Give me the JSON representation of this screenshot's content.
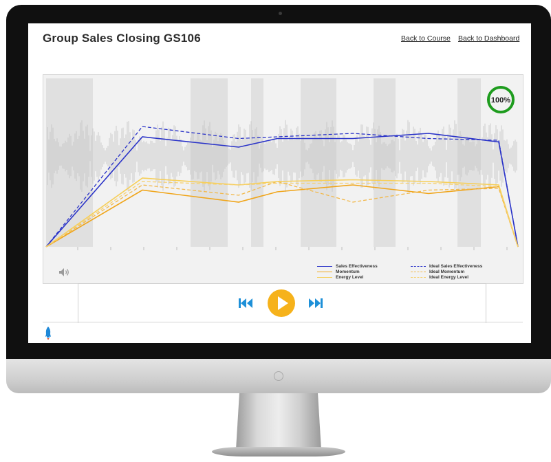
{
  "header": {
    "title": "Group Sales Closing GS106",
    "back_to_course": "Back to Course",
    "back_to_dashboard": "Back to Dashboard"
  },
  "score": {
    "label": "100%",
    "value": 100,
    "ring_color": "#1e9c1e"
  },
  "chart_data": {
    "type": "line",
    "x": [
      0,
      1,
      2,
      3,
      4,
      5,
      6,
      7
    ],
    "ylim": [
      0,
      100
    ],
    "grid": false,
    "series": [
      {
        "name": "Sales Effectiveness",
        "color": "#2a33c8",
        "dash": false,
        "values": [
          0,
          64,
          58,
          63,
          63,
          66,
          61,
          0
        ]
      },
      {
        "name": "Ideal Sales Effectiveness",
        "color": "#2a33c8",
        "dash": true,
        "values": [
          0,
          70,
          63,
          64,
          66,
          63,
          62,
          0
        ]
      },
      {
        "name": "Momentum",
        "color": "#f0a51a",
        "dash": false,
        "values": [
          0,
          33,
          26,
          32,
          36,
          31,
          35,
          0
        ]
      },
      {
        "name": "Ideal Momentum",
        "color": "#f2b84a",
        "dash": true,
        "values": [
          0,
          36,
          30,
          38,
          26,
          33,
          34,
          0
        ]
      },
      {
        "name": "Energy Level",
        "color": "#f6cf5a",
        "dash": false,
        "values": [
          0,
          40,
          36,
          38,
          39,
          38,
          36,
          0
        ]
      },
      {
        "name": "Ideal Energy Level",
        "color": "#f6d070",
        "dash": true,
        "values": [
          0,
          38,
          36,
          37,
          37,
          37,
          35,
          0
        ]
      }
    ]
  },
  "legend": {
    "left": [
      "Sales Effectiveness",
      "Momentum",
      "Energy Level"
    ],
    "right": [
      "Ideal Sales Effectiveness",
      "Ideal Momentum",
      "Ideal Energy Level"
    ]
  },
  "icons": {
    "volume": "speaker-icon",
    "prev": "skip-back-icon",
    "play": "play-icon",
    "next": "skip-forward-icon",
    "marker": "rocket-icon"
  },
  "colors": {
    "accent": "#f6b21b",
    "controls": "#1e90d8",
    "waveform": "#c6c6c6"
  }
}
